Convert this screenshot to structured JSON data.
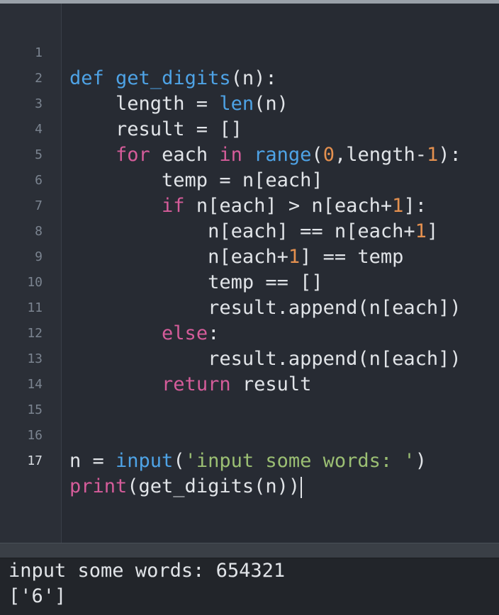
{
  "editor": {
    "line_numbers": [
      "1",
      "2",
      "3",
      "4",
      "5",
      "6",
      "7",
      "8",
      "9",
      "10",
      "11",
      "12",
      "13",
      "14",
      "15",
      "16",
      "17"
    ],
    "lines": [
      {
        "tokens": [
          "def",
          " ",
          "get_digits",
          "(n):"
        ]
      },
      {
        "tokens": [
          "    length = ",
          "len",
          "(n)"
        ]
      },
      {
        "tokens": [
          "    result = []"
        ]
      },
      {
        "tokens": [
          "    ",
          "for",
          " each ",
          "in",
          " ",
          "range",
          "(",
          "0",
          ",length-",
          "1",
          "):"
        ]
      },
      {
        "tokens": [
          "        temp = n[each]"
        ]
      },
      {
        "tokens": [
          "        ",
          "if",
          " n[each] > n[each+",
          "1",
          "]:"
        ]
      },
      {
        "tokens": [
          "            n[each] == n[each+",
          "1",
          "]"
        ]
      },
      {
        "tokens": [
          "            n[each+",
          "1",
          "] == temp"
        ]
      },
      {
        "tokens": [
          "            temp == []"
        ]
      },
      {
        "tokens": [
          "            result.append(n[each])"
        ]
      },
      {
        "tokens": [
          "        ",
          "else",
          ":"
        ]
      },
      {
        "tokens": [
          "            result.append(n[each])"
        ]
      },
      {
        "tokens": [
          "        ",
          "return",
          " result"
        ]
      },
      {
        "tokens": [
          ""
        ]
      },
      {
        "tokens": [
          ""
        ]
      },
      {
        "tokens": [
          "n = ",
          "input",
          "(",
          "'input some words: '",
          ")"
        ]
      },
      {
        "tokens": [
          "print",
          "(get_digits(n))"
        ]
      }
    ]
  },
  "console": {
    "lines": [
      "input some words: 654321",
      "['6']"
    ]
  },
  "colors": {
    "background": "#272b33",
    "keyword_blue": "#4ea3e6",
    "control_pink": "#d55c9a",
    "number_orange": "#e4904f",
    "string_green": "#9bbf73",
    "text": "#e1e4e8"
  }
}
